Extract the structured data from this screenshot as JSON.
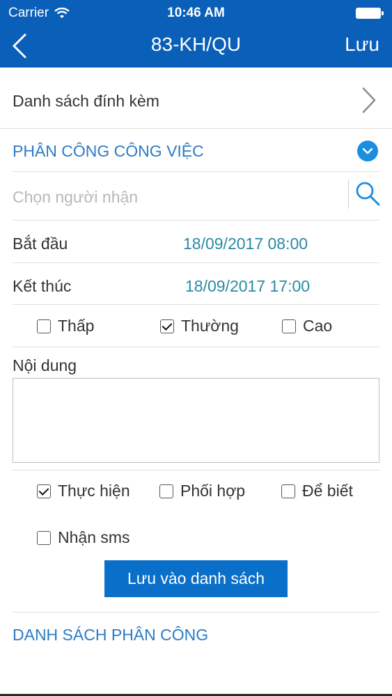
{
  "status_bar": {
    "carrier": "Carrier",
    "time": "10:46 AM"
  },
  "nav": {
    "title": "83-KH/QU",
    "save_label": "Lưu"
  },
  "attachments": {
    "label": "Danh sách đính kèm"
  },
  "assign_section": {
    "title": "PHÂN CÔNG CÔNG VIỆC"
  },
  "recipient": {
    "placeholder": "Chọn người nhận"
  },
  "schedule": {
    "start_label": "Bắt đầu",
    "start_value": "18/09/2017 08:00",
    "end_label": "Kết thúc",
    "end_value": "18/09/2017 17:00"
  },
  "priority": {
    "options": [
      {
        "label": "Thấp",
        "checked": false
      },
      {
        "label": "Thường",
        "checked": true
      },
      {
        "label": "Cao",
        "checked": false
      }
    ]
  },
  "content": {
    "label": "Nội dung",
    "value": ""
  },
  "role": {
    "options": [
      {
        "label": "Thực hiện",
        "checked": true
      },
      {
        "label": "Phối hợp",
        "checked": false
      },
      {
        "label": "Để biết",
        "checked": false
      }
    ]
  },
  "sms": {
    "label": "Nhận sms",
    "checked": false
  },
  "add_button": {
    "label": "Lưu vào danh sách"
  },
  "assign_list": {
    "title": "DANH SÁCH PHÂN CÔNG"
  },
  "colors": {
    "header": "#0a5fb8",
    "accent": "#2a7cc7",
    "date": "#2a8aa3",
    "button": "#0a6fc8"
  },
  "icons": [
    "wifi-icon",
    "battery-icon",
    "back-chevron-icon",
    "chevron-right-icon",
    "collapse-chevron-icon",
    "search-icon",
    "checkbox-icon"
  ]
}
